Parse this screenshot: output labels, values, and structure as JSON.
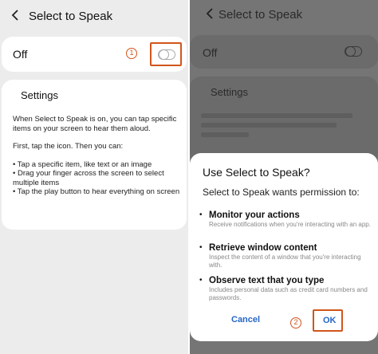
{
  "left": {
    "header": {
      "title": "Select to Speak"
    },
    "master_toggle": {
      "label": "Off",
      "state": "off",
      "step": "1"
    },
    "settings": {
      "title": "Settings",
      "description": "When Select to Speak is on, you can tap specific items on your screen to hear them aloud.",
      "intro": "First, tap the icon. Then you can:",
      "bullets": [
        "• Tap a specific item, like text or an image",
        "• Drag your finger across the screen to select multiple items",
        "• Tap the play button to hear everything on screen"
      ]
    }
  },
  "right": {
    "header": {
      "title": "Select to Speak"
    },
    "master_toggle": {
      "label": "Off"
    },
    "settings": {
      "title": "Settings"
    },
    "dialog": {
      "title": "Use Select to Speak?",
      "subtitle": "Select to Speak wants permission to:",
      "permissions": [
        {
          "title": "Monitor your actions",
          "desc": "Receive notifications when you're interacting with an app."
        },
        {
          "title": "Retrieve window content",
          "desc": "Inspect the content of a window that you're interacting with."
        },
        {
          "title": "Observe text that you type",
          "desc": "Includes personal data such as credit card numbers and passwords."
        }
      ],
      "cancel_label": "Cancel",
      "ok_label": "OK",
      "step": "2"
    }
  },
  "colors": {
    "highlight": "#d0551b",
    "button_text": "#2466c7",
    "dim_overlay": "#757575"
  }
}
